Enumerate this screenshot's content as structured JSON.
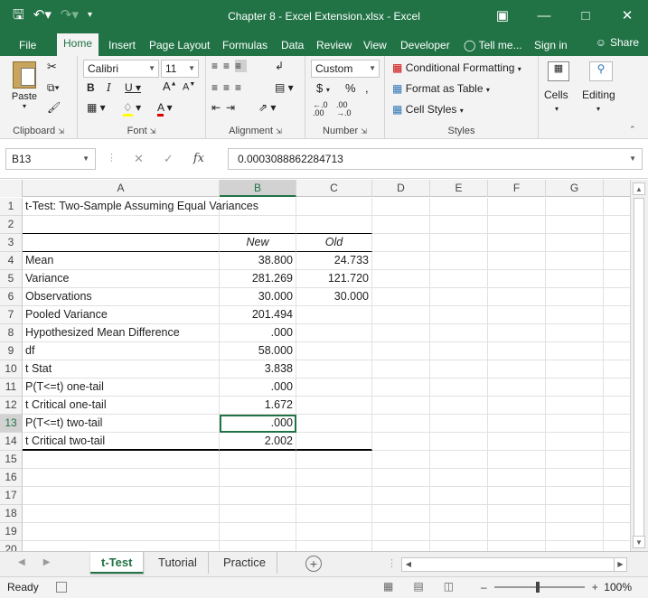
{
  "title_bar": {
    "title": "Chapter 8 - Excel Extension.xlsx - Excel",
    "save_icon": "save-icon",
    "undo_icon": "undo-icon",
    "redo_icon": "redo-icon",
    "window_buttons": [
      "ribbon-display-icon",
      "minimize-icon",
      "maximize-icon",
      "close-icon"
    ]
  },
  "ribbon_tabs": [
    {
      "label": "File"
    },
    {
      "label": "Home"
    },
    {
      "label": "Insert"
    },
    {
      "label": "Page Layout"
    },
    {
      "label": "Formulas"
    },
    {
      "label": "Data"
    },
    {
      "label": "Review"
    },
    {
      "label": "View"
    },
    {
      "label": "Developer"
    },
    {
      "label": "Tell me..."
    },
    {
      "label": "Sign in"
    },
    {
      "label": "Share"
    }
  ],
  "active_tab": "Home",
  "ribbon": {
    "clipboard": {
      "label": "Clipboard",
      "paste": "Paste"
    },
    "font": {
      "label": "Font",
      "name": "Calibri",
      "size": "11"
    },
    "alignment": {
      "label": "Alignment"
    },
    "number": {
      "label": "Number",
      "format": "Custom",
      "currency": "$",
      "percent": "%",
      "comma": ","
    },
    "styles": {
      "label": "Styles",
      "conditional": "Conditional Formatting",
      "table": "Format as Table",
      "cell_styles": "Cell Styles"
    },
    "cells": {
      "label": "Cells"
    },
    "editing": {
      "label": "Editing"
    }
  },
  "formula_bar": {
    "name_box": "B13",
    "fx": "fx",
    "formula": "0.0003088862284713"
  },
  "columns": [
    "A",
    "B",
    "C",
    "D",
    "E",
    "F",
    "G"
  ],
  "rows": [
    {
      "num": "1",
      "a": "t-Test: Two-Sample Assuming Equal Variances",
      "b": "",
      "c": ""
    },
    {
      "num": "2",
      "a": "",
      "b": "",
      "c": ""
    },
    {
      "num": "3",
      "a": "",
      "b": "New",
      "c": "Old"
    },
    {
      "num": "4",
      "a": "Mean",
      "b": "38.800",
      "c": "24.733"
    },
    {
      "num": "5",
      "a": "Variance",
      "b": "281.269",
      "c": "121.720"
    },
    {
      "num": "6",
      "a": "Observations",
      "b": "30.000",
      "c": "30.000"
    },
    {
      "num": "7",
      "a": "Pooled Variance",
      "b": "201.494",
      "c": ""
    },
    {
      "num": "8",
      "a": "Hypothesized Mean Difference",
      "b": ".000",
      "c": ""
    },
    {
      "num": "9",
      "a": "df",
      "b": "58.000",
      "c": ""
    },
    {
      "num": "10",
      "a": "t Stat",
      "b": "3.838",
      "c": ""
    },
    {
      "num": "11",
      "a": "P(T<=t) one-tail",
      "b": ".000",
      "c": ""
    },
    {
      "num": "12",
      "a": "t Critical one-tail",
      "b": "1.672",
      "c": ""
    },
    {
      "num": "13",
      "a": "P(T<=t) two-tail",
      "b": ".000",
      "c": ""
    },
    {
      "num": "14",
      "a": "t Critical two-tail",
      "b": "2.002",
      "c": ""
    },
    {
      "num": "15",
      "a": "",
      "b": "",
      "c": ""
    },
    {
      "num": "16",
      "a": "",
      "b": "",
      "c": ""
    },
    {
      "num": "17",
      "a": "",
      "b": "",
      "c": ""
    },
    {
      "num": "18",
      "a": "",
      "b": "",
      "c": ""
    },
    {
      "num": "19",
      "a": "",
      "b": "",
      "c": ""
    },
    {
      "num": "20",
      "a": "",
      "b": "",
      "c": ""
    }
  ],
  "selected_cell": "B13",
  "sheets": [
    {
      "label": "t-Test",
      "active": true
    },
    {
      "label": "Tutorial",
      "active": false
    },
    {
      "label": "Practice",
      "active": false
    }
  ],
  "status": {
    "mode": "Ready",
    "zoom": "100%"
  },
  "colors": {
    "brand": "#217346",
    "ribbon_bg": "#f3f3f3"
  }
}
